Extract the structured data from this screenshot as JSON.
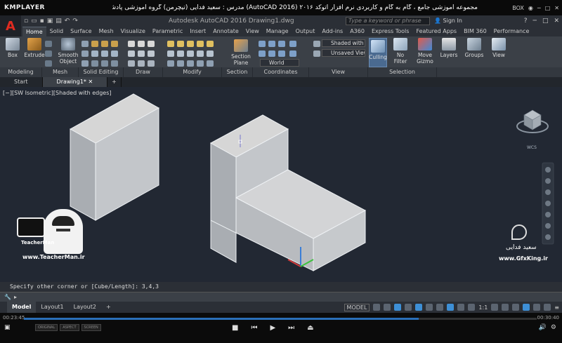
{
  "player": {
    "logo": "KMPLAYER",
    "title": "مجموعه آموزشی جامع ، گام به گام و کاربردی نرم افزار اتوکد ۲۰۱۶ (AutoCAD 2016) مدرس : سعید فدایی (تیچرمن) گروه آموزشی پادشاه گرافیست ها",
    "right_label": "BOX",
    "time_elapsed": "00:23:45",
    "time_total": "00:30:40",
    "progress_fraction": 0.77,
    "chips": [
      "ORIGINAL",
      "ASPECT",
      "SCREEN"
    ]
  },
  "app": {
    "logo_letter": "A",
    "doc_title": "Autodesk AutoCAD 2016   Drawing1.dwg",
    "search_placeholder": "Type a keyword or phrase",
    "sign_in": "Sign In"
  },
  "ribbon_tabs": [
    "Home",
    "Solid",
    "Surface",
    "Mesh",
    "Visualize",
    "Parametric",
    "Insert",
    "Annotate",
    "View",
    "Manage",
    "Output",
    "Add-ins",
    "A360",
    "Express Tools",
    "Featured Apps",
    "BIM 360",
    "Performance"
  ],
  "tools": {
    "box": "Box",
    "extrude": "Extrude",
    "smooth_object": "Smooth Object",
    "section_plane": "Section Plane",
    "culling": "Culling",
    "no_filter": "No Filter",
    "move_gizmo": "Move Gizmo",
    "layers": "Layers",
    "groups": "Groups",
    "view": "View",
    "visual_style": "Shaded with e...",
    "saved_view": "Unsaved View",
    "coord_system": "World"
  },
  "panels": [
    "Modeling",
    "Mesh",
    "Solid Editing",
    "Draw",
    "Modify",
    "Section",
    "Coordinates",
    "View",
    "Selection"
  ],
  "file_tabs": [
    "Start",
    "Drawing1*"
  ],
  "viewport": {
    "label": "[−][SW Isometric][Shaded with edges]",
    "viewcube_label": "WCS",
    "watermark_left": "www.TeacherMan.ir",
    "watermark_left_brand": "TeacherMan",
    "watermark_right_name": "سعید فدایی",
    "watermark_right_site": "www.GfxKing.ir"
  },
  "command": {
    "history": "Specify other corner or [Cube/Length]: 3,4,3",
    "prompt": ""
  },
  "layout_tabs": [
    "Model",
    "Layout1",
    "Layout2"
  ],
  "status": {
    "model": "MODEL",
    "scale": "1:1"
  }
}
